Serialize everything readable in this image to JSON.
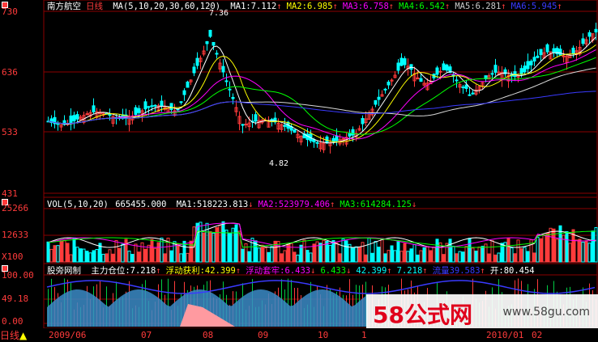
{
  "stock": {
    "name": "南方航空",
    "period": "日线"
  },
  "main_axis": {
    "labels": [
      "730",
      "636",
      "533",
      "431"
    ]
  },
  "main_header": {
    "ma_params": "MA(5,10,20,30,60,120)",
    "items": [
      {
        "label": "MA1:",
        "value": "7.112",
        "arrow": "↑",
        "color": "#ffffff"
      },
      {
        "label": "MA2:",
        "value": "6.985",
        "arrow": "↑",
        "color": "#ffff00"
      },
      {
        "label": "MA3:",
        "value": "6.758",
        "arrow": "↑",
        "color": "#ff00ff"
      },
      {
        "label": "MA4:",
        "value": "6.542",
        "arrow": "↑",
        "color": "#00ff00"
      },
      {
        "label": "MA5:",
        "value": "6.281",
        "arrow": "↑",
        "color": "#cccccc"
      },
      {
        "label": "MA6:",
        "value": "5.945",
        "arrow": "↑",
        "color": "#3a3aff"
      }
    ]
  },
  "annotations": {
    "high_label": "7.36",
    "low_label": "4.82"
  },
  "vol_axis": {
    "labels": [
      "25266",
      "12633",
      "X100"
    ]
  },
  "vol_header": {
    "params": "VOL(5,10,20)",
    "value": "665455.000",
    "items": [
      {
        "label": "MA1:",
        "value": "518223.813",
        "arrow": "↓",
        "color": "#ffffff"
      },
      {
        "label": "MA2:",
        "value": "523979.406",
        "arrow": "↑",
        "color": "#ff00ff"
      },
      {
        "label": "MA3:",
        "value": "614284.125",
        "arrow": "↓",
        "color": "#00ff00"
      }
    ]
  },
  "ind_axis": {
    "labels": [
      "100.00",
      "49.18",
      "0.00"
    ]
  },
  "ind_header": {
    "name": "股旁网制",
    "items": [
      {
        "label": "主力仓位:",
        "value": "7.218",
        "arrow": "↑",
        "color": "#ffffff"
      },
      {
        "label": "浮动获利:",
        "value": "42.399",
        "arrow": "↑",
        "color": "#ffff00"
      },
      {
        "label": "浮动套牢:",
        "value": "6.433",
        "arrow": "↓",
        "color": "#ff00ff"
      },
      {
        "label": "",
        "value": "6.433",
        "arrow": "↓",
        "color": "#00ff00"
      },
      {
        "label": "",
        "value": "42.399",
        "arrow": "↑",
        "color": "#00ffff"
      },
      {
        "label": "",
        "value": "7.218",
        "arrow": "↑",
        "color": "#00ffff"
      },
      {
        "label": "流量",
        "value": "39.583",
        "arrow": "↑",
        "color": "#3a3aff"
      },
      {
        "label": "开:",
        "value": "80.454",
        "arrow": "",
        "color": "#ffffff"
      }
    ]
  },
  "x_axis": {
    "ticks": [
      "2009/06",
      "07",
      "08",
      "09",
      "10",
      "1",
      "2010/01",
      "02"
    ]
  },
  "tab": {
    "label": "日线"
  },
  "watermark": {
    "big": "58公式网",
    "small": "www.58gu.com"
  },
  "colors": {
    "up": "#ff3b3b",
    "down": "#00ffff",
    "grid": "#8b0000",
    "ma1": "#ffffff",
    "ma2": "#ffff00",
    "ma3": "#ff00ff",
    "ma4": "#00ff00",
    "ma5": "#d8d8d8",
    "ma6": "#3a3aff"
  }
}
